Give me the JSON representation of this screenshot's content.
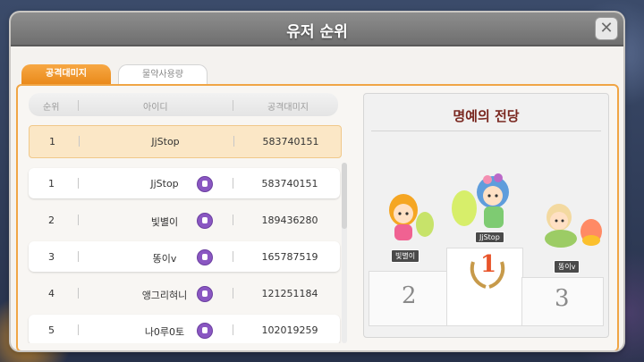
{
  "window": {
    "title": "유저 순위"
  },
  "tabs": [
    {
      "label": "공격대미지",
      "active": true
    },
    {
      "label": "물약사용량",
      "active": false
    }
  ],
  "table": {
    "headers": [
      "순위",
      "아이디",
      "공격대미지"
    ],
    "my_row": {
      "rank": "1",
      "id": "JjStop",
      "damage": "583740151"
    },
    "rows": [
      {
        "rank": "1",
        "id": "JjStop",
        "damage": "583740151"
      },
      {
        "rank": "2",
        "id": "빛별이",
        "damage": "189436280"
      },
      {
        "rank": "3",
        "id": "똥이v",
        "damage": "165787519"
      },
      {
        "rank": "4",
        "id": "앵그리혀니",
        "damage": "121251184"
      },
      {
        "rank": "5",
        "id": "나0루0토",
        "damage": "102019259"
      }
    ]
  },
  "hall_of_fame": {
    "title": "명예의 전당",
    "first": {
      "name": "JjStop",
      "place": "1"
    },
    "second": {
      "name": "빛별이",
      "place": "2"
    },
    "third": {
      "name": "똥이v",
      "place": "3"
    }
  },
  "colors": {
    "accent": "#f0a545",
    "title_bar": "#7f7f7f",
    "hof_title": "#7a2820",
    "first_place": "#e8542a"
  }
}
